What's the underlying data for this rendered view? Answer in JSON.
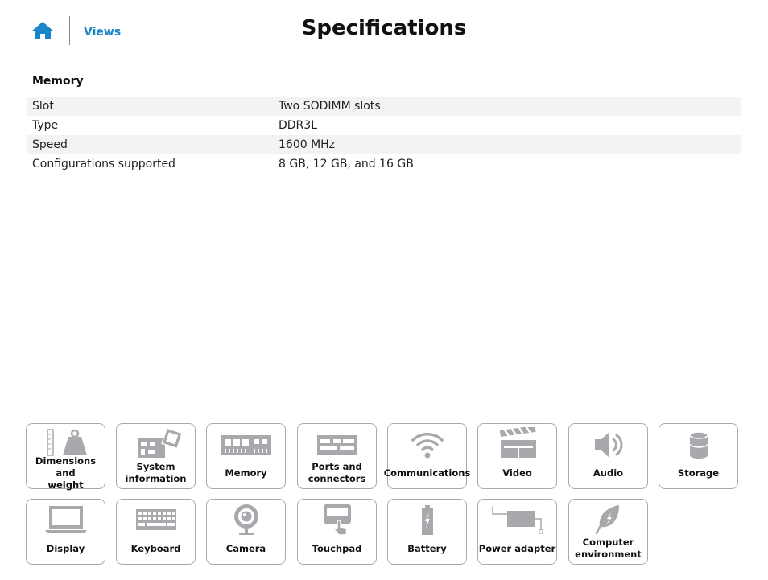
{
  "header": {
    "views_label": "Views",
    "title": "Specifications"
  },
  "section": {
    "title": "Memory",
    "rows": [
      {
        "key": "Slot",
        "value": "Two SODIMM slots"
      },
      {
        "key": "Type",
        "value": "DDR3L"
      },
      {
        "key": "Speed",
        "value": "1600 MHz"
      },
      {
        "key": "Configurations supported",
        "value": "8 GB, 12 GB, and 16 GB"
      }
    ]
  },
  "nav": {
    "tiles": [
      {
        "label": "Dimensions and\nweight",
        "icon": "weight-icon"
      },
      {
        "label": "System\ninformation",
        "icon": "motherboard-icon"
      },
      {
        "label": "Memory",
        "icon": "memory-icon"
      },
      {
        "label": "Ports and\nconnectors",
        "icon": "ports-icon"
      },
      {
        "label": "Communications",
        "icon": "wifi-icon"
      },
      {
        "label": "Video",
        "icon": "clapperboard-icon"
      },
      {
        "label": "Audio",
        "icon": "speaker-icon"
      },
      {
        "label": "Storage",
        "icon": "storage-icon"
      },
      {
        "label": "Display",
        "icon": "laptop-icon"
      },
      {
        "label": "Keyboard",
        "icon": "keyboard-icon"
      },
      {
        "label": "Camera",
        "icon": "camera-icon"
      },
      {
        "label": "Touchpad",
        "icon": "touchpad-icon"
      },
      {
        "label": "Battery",
        "icon": "battery-icon"
      },
      {
        "label": "Power adapter",
        "icon": "power-adapter-icon"
      },
      {
        "label": "Computer\nenvironment",
        "icon": "leaf-icon"
      }
    ]
  },
  "colors": {
    "accent": "#1a86c7",
    "icon_gray": "#a7a9ac"
  }
}
